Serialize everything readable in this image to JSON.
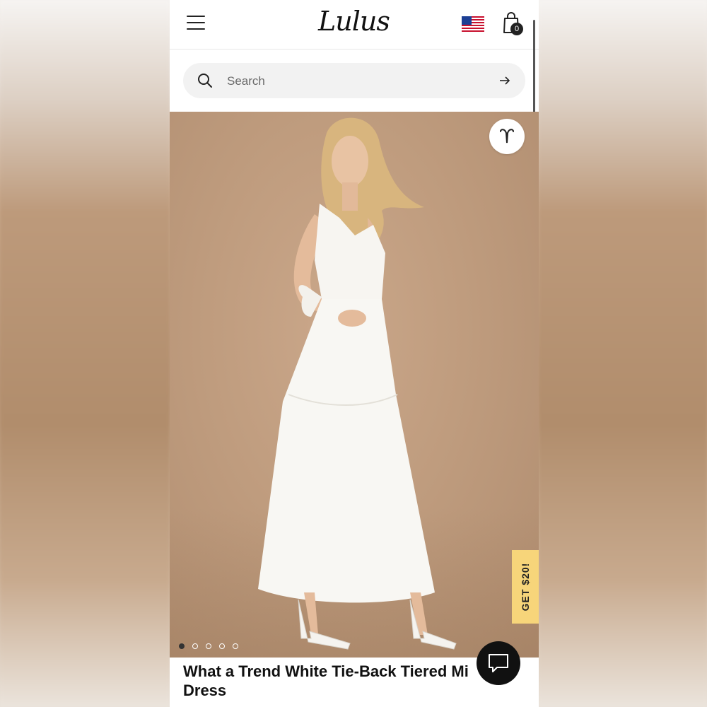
{
  "header": {
    "logo_text": "Lulus",
    "cart_count": "0",
    "flag": "us-flag-icon"
  },
  "search": {
    "placeholder": "Search"
  },
  "hero": {
    "slide_count": 5,
    "active_slide": 1
  },
  "promo": {
    "label": "GET $20!"
  },
  "product": {
    "title_line1": "What a Trend White Tie-Back Tiered Mi",
    "title_line2": "Dress"
  },
  "colors": {
    "hero_bg": "#bf9c7e",
    "promo_bg": "#f7d57a",
    "chat_bg": "#111111"
  }
}
